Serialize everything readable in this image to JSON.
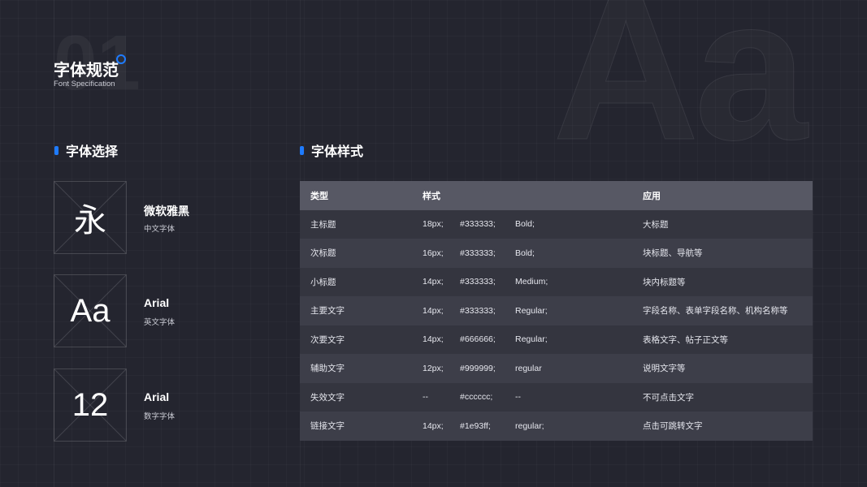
{
  "page": {
    "bg_number": "01",
    "title": "字体规范",
    "subtitle": "Font Specification",
    "bg_letters": "Aa",
    "accent_color": "#1e7bff"
  },
  "font_selection": {
    "title": "字体选择",
    "items": [
      {
        "glyph": "永",
        "name": "微软雅黑",
        "desc": "中文字体"
      },
      {
        "glyph": "Aa",
        "name": "Arial",
        "desc": "英文字体"
      },
      {
        "glyph": "12",
        "name": "Arial",
        "desc": "数字字体"
      }
    ]
  },
  "font_styles": {
    "title": "字体样式",
    "headers": {
      "type": "类型",
      "style": "样式",
      "app": "应用"
    },
    "rows": [
      {
        "type": "主标题",
        "size": "18px;",
        "color": "#333333;",
        "weight": "Bold;",
        "app": "大标题"
      },
      {
        "type": "次标题",
        "size": "16px;",
        "color": "#333333;",
        "weight": "Bold;",
        "app": "块标题、导航等"
      },
      {
        "type": "小标题",
        "size": "14px;",
        "color": "#333333;",
        "weight": "Medium;",
        "app": "块内标题等"
      },
      {
        "type": "主要文字",
        "size": "14px;",
        "color": "#333333;",
        "weight": "Regular;",
        "app": "字段名称、表单字段名称、机构名称等"
      },
      {
        "type": "次要文字",
        "size": "14px;",
        "color": "#666666;",
        "weight": "Regular;",
        "app": "表格文字、帖子正文等"
      },
      {
        "type": "辅助文字",
        "size": "12px;",
        "color": "#999999;",
        "weight": "regular",
        "app": "说明文字等"
      },
      {
        "type": "失效文字",
        "size": "--",
        "color": "#cccccc;",
        "weight": "--",
        "app": "不可点击文字"
      },
      {
        "type": "链接文字",
        "size": "14px;",
        "color": "#1e93ff;",
        "weight": "regular;",
        "app": "点击可跳转文字"
      }
    ]
  }
}
